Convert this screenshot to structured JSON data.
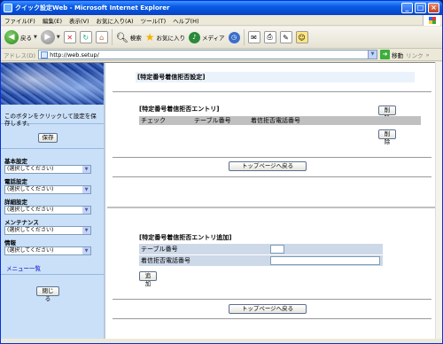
{
  "window": {
    "title": "クイック設定Web - Microsoft Internet Explorer"
  },
  "menubar": {
    "items": [
      "ファイル(F)",
      "編集(E)",
      "表示(V)",
      "お気に入り(A)",
      "ツール(T)",
      "ヘルプ(H)"
    ]
  },
  "toolbar": {
    "back_label": "戻る",
    "search_label": "検索",
    "favorites_label": "お気に入り",
    "media_label": "メディア"
  },
  "addressbar": {
    "label": "アドレス(D)",
    "url": "http://web.setup/",
    "go_label": "移動",
    "links_label": "リンク"
  },
  "sidebar": {
    "save_note": "このボタンをクリックして設定を保存します。",
    "save_label": "保存",
    "groups": [
      {
        "label": "基本設定",
        "selected": "(選択してください)"
      },
      {
        "label": "電話設定",
        "selected": "(選択してください)"
      },
      {
        "label": "詳細設定",
        "selected": "(選択してください)"
      },
      {
        "label": "メンテナンス",
        "selected": "(選択してください)"
      },
      {
        "label": "情報",
        "selected": "(選択してください)"
      }
    ],
    "menu_link": "メニュー一覧",
    "close_label": "閉じる"
  },
  "upper": {
    "page_title": "[特定番号着信拒否設定]",
    "entry_title": "[特定番号着信拒否エントリ]",
    "delete_label": "削除",
    "columns": [
      "チェック",
      "テーブル番号",
      "着信拒否電話番号"
    ],
    "delete2_label": "削除",
    "top_label": "トップページへ戻る"
  },
  "lower": {
    "add_title": "[特定番号着信拒否エントリ追加]",
    "table_no_label": "テーブル番号",
    "table_no_value": "",
    "phone_label": "着信拒否電話番号",
    "phone_value": "",
    "add_label": "追加",
    "top_label": "トップページへ戻る"
  }
}
